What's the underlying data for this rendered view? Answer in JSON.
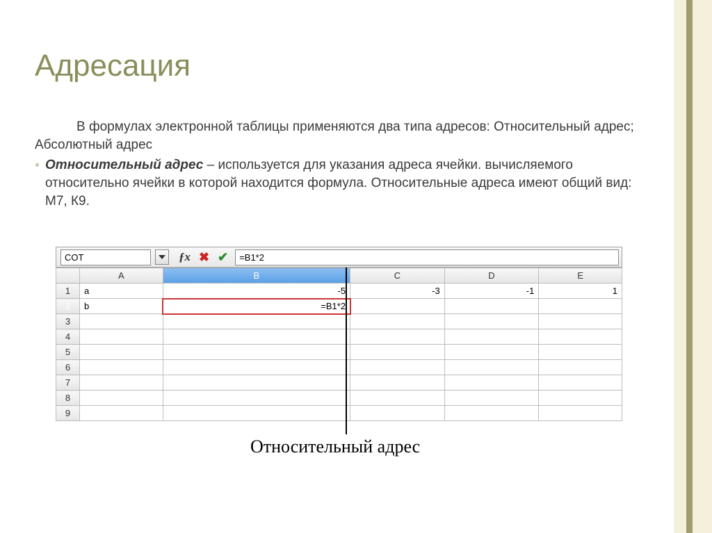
{
  "title": "Адресация",
  "paragraph1": "В формулах электронной таблицы применяются два типа адресов: Относительный адрес; Абсолютный адрес",
  "bullet": {
    "term": "Относительный адрес",
    "rest": " – используется для указания адреса ячейки. вычисляемого относительно ячейки в которой находится формула. Относительные адреса имеют общий вид: М7, К9."
  },
  "formula_bar": {
    "namebox": "COT",
    "formula": "=B1*2"
  },
  "columns": [
    "A",
    "B",
    "C",
    "D",
    "E"
  ],
  "rows": [
    "1",
    "2",
    "3",
    "4",
    "5",
    "6",
    "7",
    "8",
    "9"
  ],
  "cells": {
    "A1": "a",
    "B1": "-5",
    "C1": "-3",
    "D1": "-1",
    "E1": "1",
    "A2": "b",
    "B2": "=B1*2"
  },
  "callout": "Относительный адрес"
}
